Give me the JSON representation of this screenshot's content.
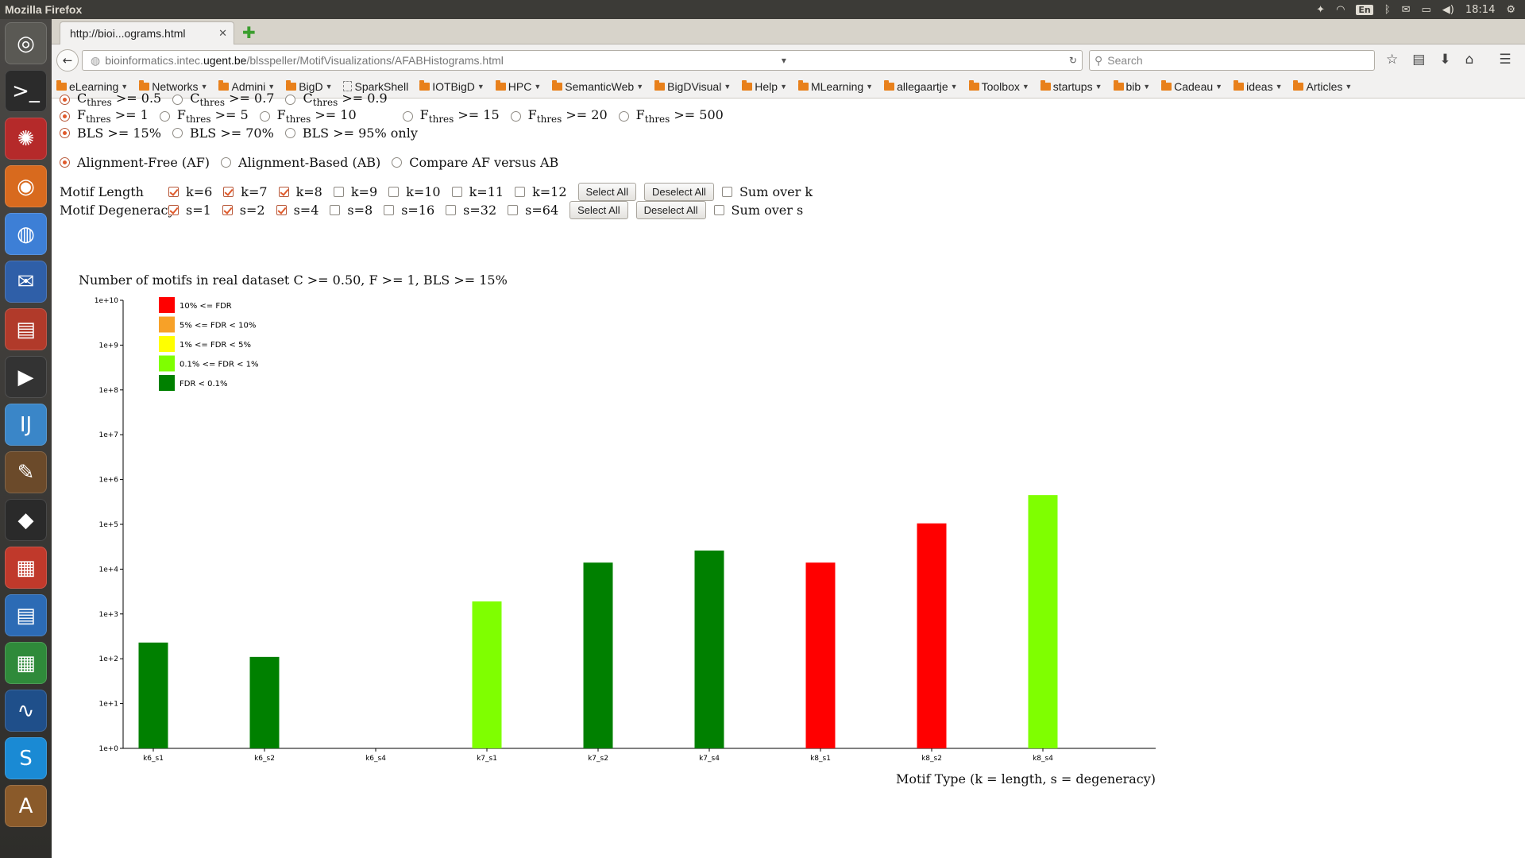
{
  "system": {
    "window_title": "Mozilla Firefox",
    "language": "En",
    "clock": "18:14"
  },
  "browser": {
    "tab_title": "http://bioi...ograms.html",
    "url_prefix": "bioinformatics.intec.",
    "url_host": "ugent.be",
    "url_path": "/blsspeller/MotifVisualizations/AFABHistograms.html",
    "search_placeholder": "Search",
    "bookmarks": [
      {
        "label": "eLearning",
        "folder": true
      },
      {
        "label": "Networks",
        "folder": true
      },
      {
        "label": "Admini",
        "folder": true
      },
      {
        "label": "BigD",
        "folder": true
      },
      {
        "label": "SparkShell",
        "folder": false
      },
      {
        "label": "IOTBigD",
        "folder": true
      },
      {
        "label": "HPC",
        "folder": true
      },
      {
        "label": "SemanticWeb",
        "folder": true
      },
      {
        "label": "BigDVisual",
        "folder": true
      },
      {
        "label": "Help",
        "folder": true
      },
      {
        "label": "MLearning",
        "folder": true
      },
      {
        "label": "allegaartje",
        "folder": true
      },
      {
        "label": "Toolbox",
        "folder": true
      },
      {
        "label": "startups",
        "folder": true
      },
      {
        "label": "bib",
        "folder": true
      },
      {
        "label": "Cadeau",
        "folder": true
      },
      {
        "label": "ideas",
        "folder": true
      },
      {
        "label": "Articles",
        "folder": true
      }
    ]
  },
  "controls": {
    "c_thres": [
      {
        "prefix": "C",
        "sub": "thres",
        "suffix": " >= 0.5",
        "checked": true
      },
      {
        "prefix": "C",
        "sub": "thres",
        "suffix": " >= 0.7",
        "checked": false
      },
      {
        "prefix": "C",
        "sub": "thres",
        "suffix": " >= 0.9",
        "checked": false
      }
    ],
    "f_thres": [
      {
        "prefix": "F",
        "sub": "thres",
        "suffix": " >= 1",
        "checked": true
      },
      {
        "prefix": "F",
        "sub": "thres",
        "suffix": " >= 5",
        "checked": false
      },
      {
        "prefix": "F",
        "sub": "thres",
        "suffix": " >= 10",
        "checked": false
      },
      {
        "prefix": "F",
        "sub": "thres",
        "suffix": " >= 15",
        "checked": false
      },
      {
        "prefix": "F",
        "sub": "thres",
        "suffix": " >= 20",
        "checked": false
      },
      {
        "prefix": "F",
        "sub": "thres",
        "suffix": " >= 500",
        "checked": false
      }
    ],
    "bls": [
      {
        "label": "BLS >= 15%",
        "checked": true
      },
      {
        "label": "BLS >= 70%",
        "checked": false
      },
      {
        "label": "BLS >= 95% only",
        "checked": false
      }
    ],
    "alignment": [
      {
        "label": "Alignment-Free (AF)",
        "checked": true
      },
      {
        "label": "Alignment-Based (AB)",
        "checked": false
      },
      {
        "label": "Compare AF versus AB",
        "checked": false
      }
    ],
    "motif_length": {
      "label": "Motif Length",
      "options": [
        {
          "label": "k=6",
          "checked": true
        },
        {
          "label": "k=7",
          "checked": true
        },
        {
          "label": "k=8",
          "checked": true
        },
        {
          "label": "k=9",
          "checked": false
        },
        {
          "label": "k=10",
          "checked": false
        },
        {
          "label": "k=11",
          "checked": false
        },
        {
          "label": "k=12",
          "checked": false
        }
      ],
      "select_all": "Select All",
      "deselect_all": "Deselect All",
      "sum_label": "Sum over k",
      "sum_checked": false
    },
    "motif_degeneracy": {
      "label": "Motif Degeneracy",
      "options": [
        {
          "label": "s=1",
          "checked": true
        },
        {
          "label": "s=2",
          "checked": true
        },
        {
          "label": "s=4",
          "checked": true
        },
        {
          "label": "s=8",
          "checked": false
        },
        {
          "label": "s=16",
          "checked": false
        },
        {
          "label": "s=32",
          "checked": false
        },
        {
          "label": "s=64",
          "checked": false
        }
      ],
      "select_all": "Select All",
      "deselect_all": "Deselect All",
      "sum_label": "Sum over s",
      "sum_checked": false
    }
  },
  "chart_data": {
    "type": "bar",
    "title": "Number of motifs in real dataset C >= 0.50, F >= 1, BLS >= 15%",
    "xlabel": "Motif Type (k = length, s = degeneracy)",
    "ylabel": "",
    "yscale": "log",
    "ylim": [
      1,
      10000000000
    ],
    "yticks": [
      "1e+0",
      "1e+1",
      "1e+2",
      "1e+3",
      "1e+4",
      "1e+5",
      "1e+6",
      "1e+7",
      "1e+8",
      "1e+9",
      "1e+10"
    ],
    "categories": [
      "k6_s1",
      "k6_s2",
      "k6_s4",
      "k7_s1",
      "k7_s2",
      "k7_s4",
      "k8_s1",
      "k8_s2",
      "k8_s4"
    ],
    "values": [
      230,
      110,
      null,
      1900,
      14000,
      26000,
      14000,
      105000,
      450000
    ],
    "colors": [
      "#008000",
      "#008000",
      null,
      "#7fff00",
      "#008000",
      "#008000",
      "#ff0000",
      "#ff0000",
      "#7fff00"
    ],
    "legend_placement": "top-left",
    "legend": [
      {
        "label": "10% <= FDR",
        "color": "#ff0000"
      },
      {
        "label": "5% <= FDR < 10%",
        "color": "#f7a128"
      },
      {
        "label": "1% <= FDR < 5%",
        "color": "#ffff00"
      },
      {
        "label": "0.1% <= FDR < 1%",
        "color": "#7fff00"
      },
      {
        "label": "FDR < 0.1%",
        "color": "#008000"
      }
    ]
  }
}
